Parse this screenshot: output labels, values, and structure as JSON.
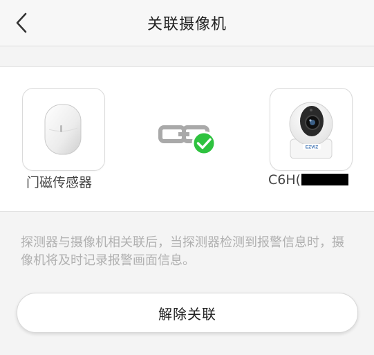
{
  "header": {
    "title": "关联摄像机",
    "back_icon": "chevron-left-icon"
  },
  "devices": {
    "sensor": {
      "name": "门磁传感器",
      "icon": "door-contact-sensor-image"
    },
    "camera": {
      "name": "C6H(",
      "icon": "ezviz-camera-image",
      "logo_text": "EZVIZ"
    }
  },
  "link_status": {
    "icon": "chain-link-icon",
    "badge_icon": "check-circle-icon",
    "badge_color": "#2ec23f"
  },
  "description": "探测器与摄像机相关联后，当探测器检测到报警信息时，摄像机将及时记录报警画面信息。",
  "actions": {
    "unlink_label": "解除关联"
  }
}
